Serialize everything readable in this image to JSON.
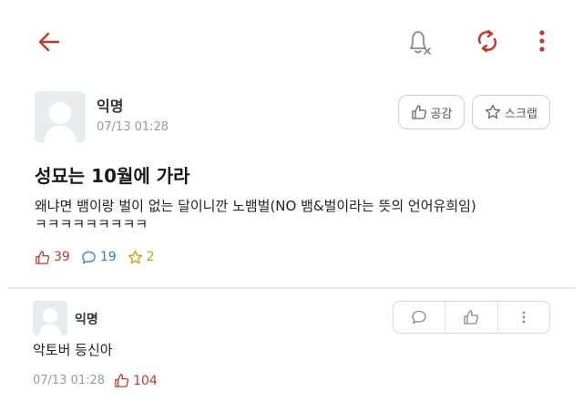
{
  "colors": {
    "accent": "#c0392b",
    "comment_blue": "#2e86c1",
    "star_yellow": "#c9a000",
    "muted": "#9a9a9a"
  },
  "topbar": {
    "back_icon": "arrow-left-icon",
    "bell_icon": "bell-off-icon",
    "refresh_icon": "refresh-icon",
    "more_icon": "more-vertical-icon"
  },
  "post": {
    "author": "익명",
    "date": "07/13 01:28",
    "like_button_label": "공감",
    "scrap_button_label": "스크랩",
    "title": "성묘는 10월에 가라",
    "body_lines": [
      "왜냐면 뱀이랑 벌이 없는 달이니깐 노뱀벌(NO 뱀&벌이라는 뜻의 언어유희임)",
      "ㅋㅋㅋㅋㅋㅋㅋㅋㅋ"
    ],
    "likes": "39",
    "comments": "19",
    "scraps": "2"
  },
  "comment": {
    "author": "익명",
    "text": "악토버 등신아",
    "date": "07/13 01:28",
    "likes": "104"
  }
}
